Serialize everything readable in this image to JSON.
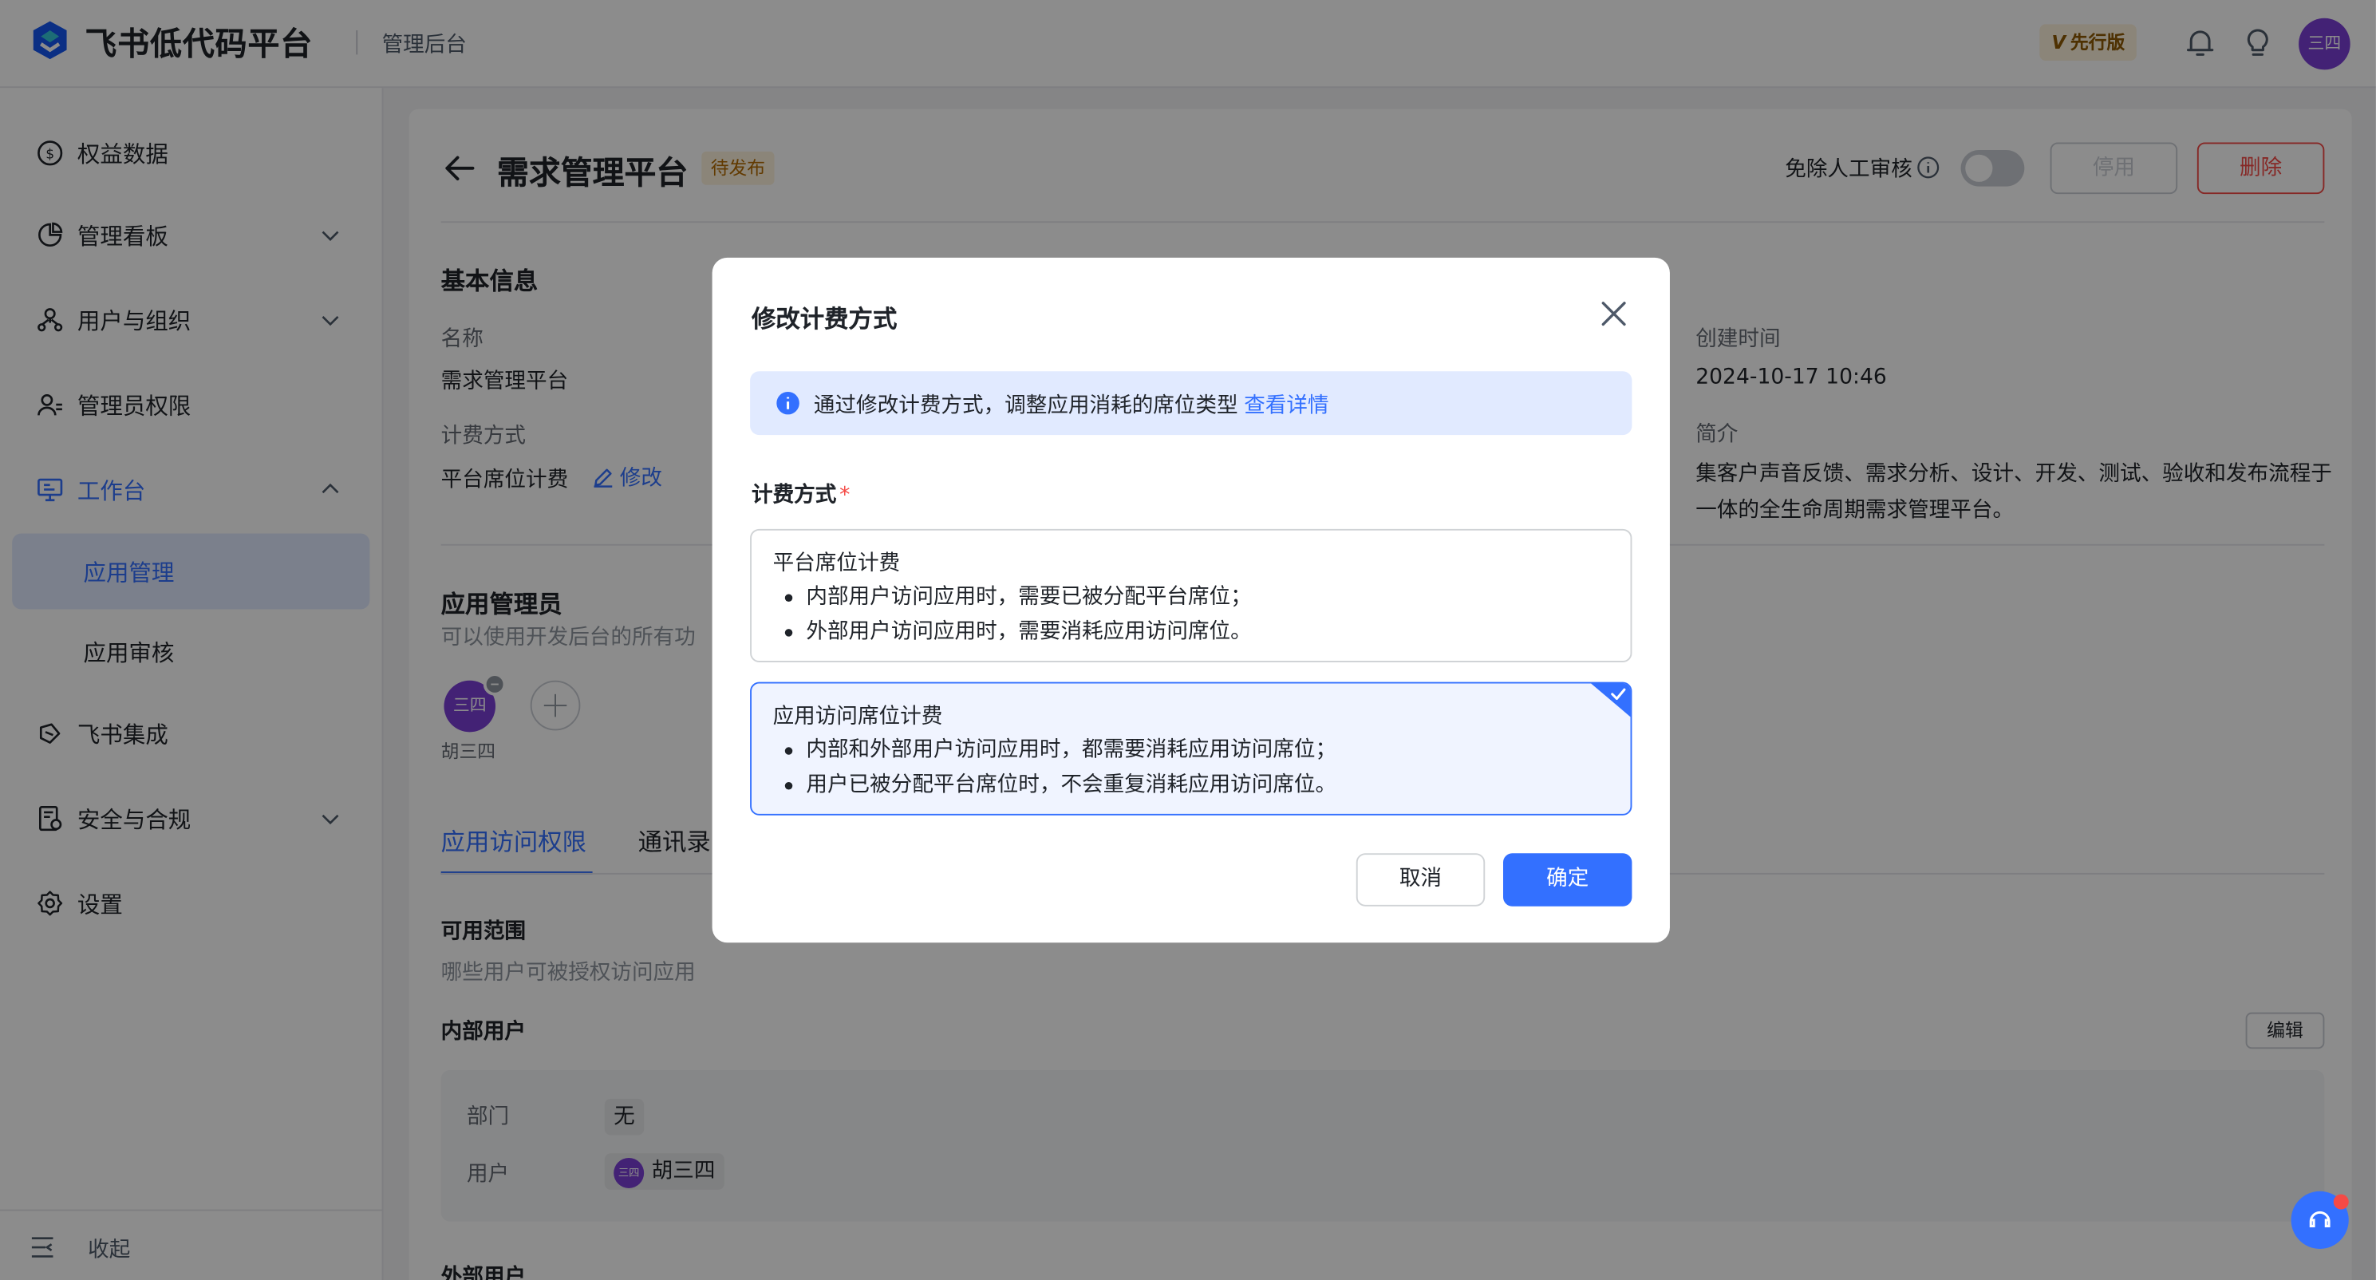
{
  "header": {
    "app_name": "飞书低代码平台",
    "subtitle": "管理后台",
    "edition_badge": "先行版",
    "edition_badge_letter": "V",
    "avatar_text": "三四"
  },
  "sidebar": {
    "items": [
      {
        "label": "权益数据",
        "icon": "dollar-circle-icon"
      },
      {
        "label": "管理看板",
        "icon": "pie-chart-icon"
      },
      {
        "label": "用户与组织",
        "icon": "org-icon"
      },
      {
        "label": "管理员权限",
        "icon": "user-admin-icon"
      },
      {
        "label": "工作台",
        "icon": "monitor-icon"
      },
      {
        "label": "应用管理"
      },
      {
        "label": "应用审核"
      },
      {
        "label": "飞书集成",
        "icon": "integration-icon"
      },
      {
        "label": "安全与合规",
        "icon": "security-icon"
      },
      {
        "label": "设置",
        "icon": "gear-icon"
      }
    ],
    "collapse_label": "收起"
  },
  "main": {
    "title": "需求管理平台",
    "status": "待发布",
    "free_review_label": "免除人工审核",
    "disable_label": "停用",
    "delete_label": "删除",
    "basic_info_title": "基本信息",
    "name_label": "名称",
    "name_value": "需求管理平台",
    "billing_label": "计费方式",
    "billing_value": "平台席位计费",
    "edit_label": "修改",
    "created_label": "创建时间",
    "created_value": "2024-10-17 10:46",
    "intro_label": "简介",
    "intro_value": "集客户声音反馈、需求分析、设计、开发、测试、验收和发布流程于一体的全生命周期需求管理平台。",
    "admin_title": "应用管理员",
    "admin_desc": "可以使用开发后台的所有功",
    "admin_avatar_text": "三四",
    "admin_name": "胡三四",
    "tabs": [
      {
        "label": "应用访问权限"
      },
      {
        "label": "通讯录"
      }
    ],
    "scope_title": "可用范围",
    "scope_desc": "哪些用户可被授权访问应用",
    "internal_users_label": "内部用户",
    "edit_small_label": "编辑",
    "dept_label": "部门",
    "dept_value": "无",
    "user_label": "用户",
    "user_chip_avatar": "三四",
    "user_chip_name": "胡三四",
    "external_users_label": "外部用户"
  },
  "modal": {
    "title": "修改计费方式",
    "notice_text": "通过修改计费方式，调整应用消耗的席位类型",
    "notice_link": "查看详情",
    "field_label": "计费方式",
    "required_mark": "*",
    "options": [
      {
        "title": "平台席位计费",
        "lines": [
          "内部用户访问应用时，需要已被分配平台席位；",
          "外部用户访问应用时，需要消耗应用访问席位。"
        ],
        "selected": false
      },
      {
        "title": "应用访问席位计费",
        "lines": [
          "内部和外部用户访问应用时，都需要消耗应用访问席位；",
          "用户已被分配平台席位时，不会重复消耗应用访问席位。"
        ],
        "selected": true
      }
    ],
    "cancel_label": "取消",
    "ok_label": "确定"
  },
  "colors": {
    "primary": "#3370ff",
    "danger": "#f54a45",
    "avatar": "#7b3fd6",
    "warning_bg": "#fdf2dc"
  }
}
